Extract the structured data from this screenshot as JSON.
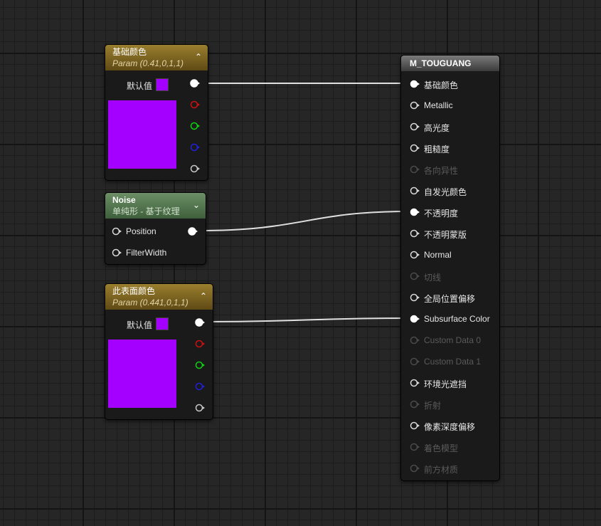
{
  "colors": {
    "param_color": "#a300ff",
    "wire": "#e0e0e0",
    "pin_r": "#d01010",
    "pin_g": "#10d010",
    "pin_b": "#2020d8",
    "pin_a": "#c8c8c8"
  },
  "base_color_node": {
    "title": "基础颜色",
    "subtitle": "Param (0.41,0,1,1)",
    "default_label": "默认值",
    "collapse_icon": "chevron-up-icon"
  },
  "noise_node": {
    "title": "Noise",
    "subtitle": "单纯形 - 基于纹理",
    "inputs": [
      "Position",
      "FilterWidth"
    ],
    "collapse_icon": "chevron-down-icon"
  },
  "subsurface_node": {
    "title": "此表面颜色",
    "subtitle": "Param (0.441,0,1,1)",
    "default_label": "默认值",
    "collapse_icon": "chevron-up-icon"
  },
  "material_node": {
    "title": "M_TOUGUANG",
    "pins": [
      {
        "label": "基础颜色",
        "state": "connected"
      },
      {
        "label": "Metallic",
        "state": "active"
      },
      {
        "label": "高光度",
        "state": "active"
      },
      {
        "label": "粗糙度",
        "state": "active"
      },
      {
        "label": "各向异性",
        "state": "disabled"
      },
      {
        "label": "自发光颜色",
        "state": "active"
      },
      {
        "label": "不透明度",
        "state": "connected"
      },
      {
        "label": "不透明蒙版",
        "state": "active"
      },
      {
        "label": "Normal",
        "state": "active"
      },
      {
        "label": "切线",
        "state": "disabled"
      },
      {
        "label": "全局位置偏移",
        "state": "active"
      },
      {
        "label": "Subsurface Color",
        "state": "connected"
      },
      {
        "label": "Custom Data 0",
        "state": "disabled"
      },
      {
        "label": "Custom Data 1",
        "state": "disabled"
      },
      {
        "label": "环境光遮挡",
        "state": "active"
      },
      {
        "label": "折射",
        "state": "disabled"
      },
      {
        "label": "像素深度偏移",
        "state": "active"
      },
      {
        "label": "着色模型",
        "state": "disabled"
      },
      {
        "label": "前方材质",
        "state": "disabled"
      }
    ]
  }
}
